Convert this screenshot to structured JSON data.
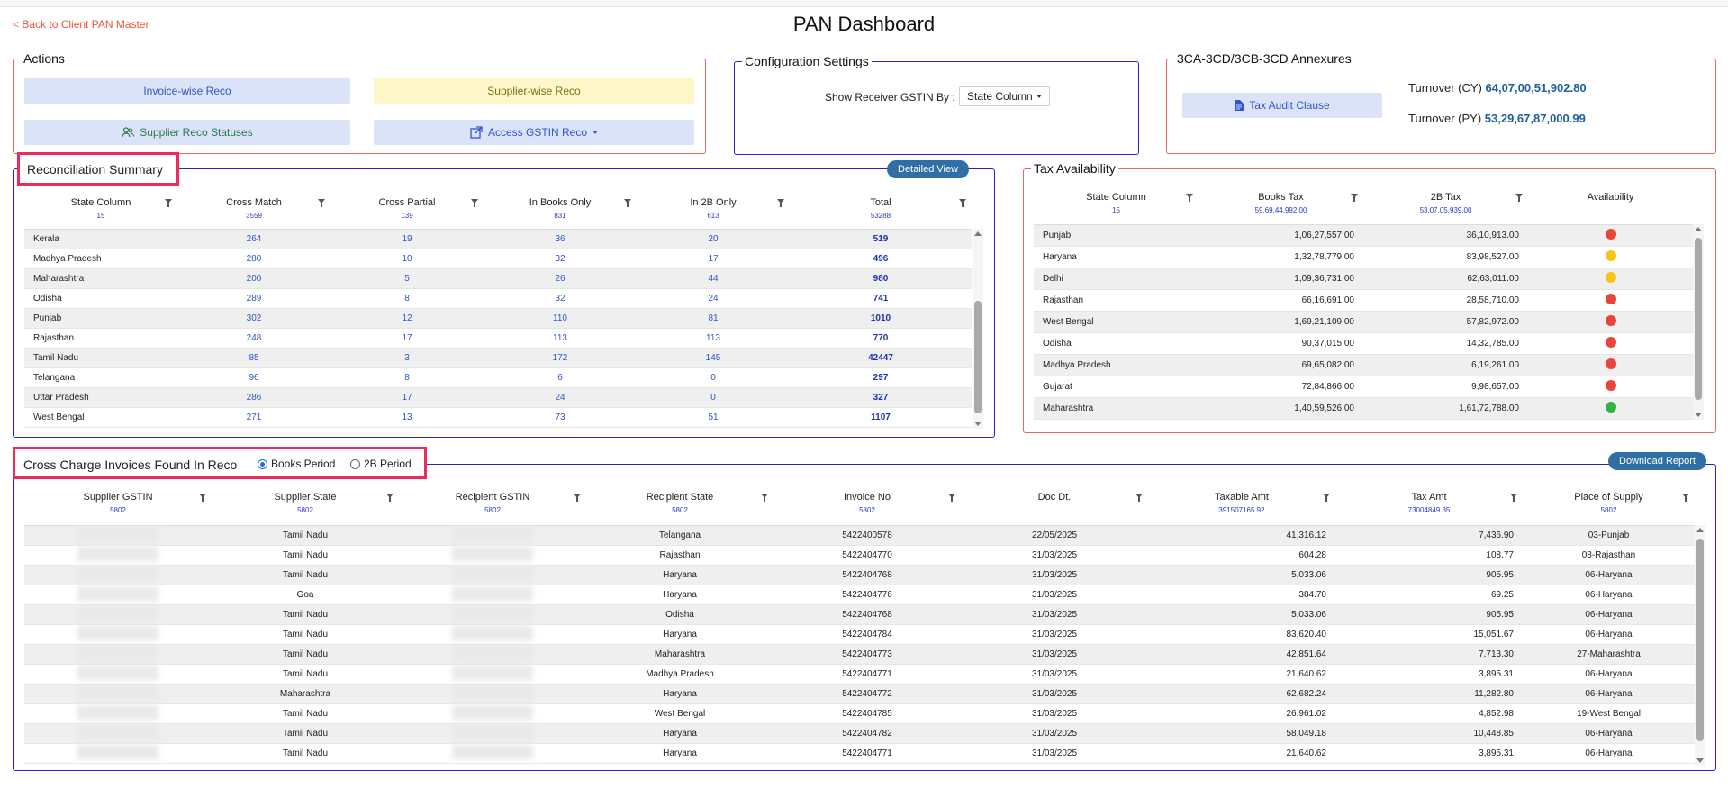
{
  "header": {
    "back_link": "< Back to Client PAN Master",
    "title": "PAN Dashboard"
  },
  "actions": {
    "legend": "Actions",
    "invoice_wise": "Invoice-wise Reco",
    "supplier_wise": "Supplier-wise Reco",
    "supplier_statuses": "Supplier Reco Statuses",
    "access_gstin": "Access GSTIN Reco"
  },
  "config": {
    "legend": "Configuration Settings",
    "label": "Show Receiver GSTIN By :",
    "selected": "State Column"
  },
  "annex": {
    "legend": "3CA-3CD/3CB-3CD Annexures",
    "button": "Tax Audit Clause",
    "turnover_cy_label": "Turnover (CY)",
    "turnover_cy": "64,07,00,51,902.80",
    "turnover_py_label": "Turnover (PY)",
    "turnover_py": "53,29,67,87,000.99"
  },
  "reco": {
    "legend": "Reconciliation Summary",
    "detailed_view": "Detailed View",
    "headers": [
      {
        "label": "State Column",
        "count": "15"
      },
      {
        "label": "Cross Match",
        "count": "3559"
      },
      {
        "label": "Cross Partial",
        "count": "139"
      },
      {
        "label": "In Books Only",
        "count": "831"
      },
      {
        "label": "In 2B Only",
        "count": "613"
      },
      {
        "label": "Total",
        "count": "53288"
      }
    ],
    "rows": [
      [
        "Kerala",
        "264",
        "19",
        "36",
        "20",
        "519"
      ],
      [
        "Madhya Pradesh",
        "280",
        "10",
        "32",
        "17",
        "496"
      ],
      [
        "Maharashtra",
        "200",
        "5",
        "26",
        "44",
        "980"
      ],
      [
        "Odisha",
        "289",
        "8",
        "32",
        "24",
        "741"
      ],
      [
        "Punjab",
        "302",
        "12",
        "110",
        "81",
        "1010"
      ],
      [
        "Rajasthan",
        "248",
        "17",
        "113",
        "113",
        "770"
      ],
      [
        "Tamil Nadu",
        "85",
        "3",
        "172",
        "145",
        "42447"
      ],
      [
        "Telangana",
        "96",
        "8",
        "6",
        "0",
        "297"
      ],
      [
        "Uttar Pradesh",
        "286",
        "17",
        "24",
        "0",
        "327"
      ],
      [
        "West Bengal",
        "271",
        "13",
        "73",
        "51",
        "1107"
      ]
    ]
  },
  "tax": {
    "legend": "Tax Availability",
    "headers": [
      {
        "label": "State Column",
        "count": "15"
      },
      {
        "label": "Books Tax",
        "count": "59,69,44,992.00"
      },
      {
        "label": "2B Tax",
        "count": "53,07,05,939.00"
      },
      {
        "label": "Availability",
        "count": ""
      }
    ],
    "colors": {
      "red": "#e8453c",
      "yellow": "#f5c518",
      "green": "#2fb344"
    },
    "rows": [
      {
        "state": "Punjab",
        "books": "1,06,27,557.00",
        "tax2b": "36,10,913.00",
        "status": "red"
      },
      {
        "state": "Haryana",
        "books": "1,32,78,779.00",
        "tax2b": "83,98,527.00",
        "status": "yellow"
      },
      {
        "state": "Delhi",
        "books": "1,09,36,731.00",
        "tax2b": "62,63,011.00",
        "status": "yellow"
      },
      {
        "state": "Rajasthan",
        "books": "66,16,691.00",
        "tax2b": "28,58,710.00",
        "status": "red"
      },
      {
        "state": "West Bengal",
        "books": "1,69,21,109.00",
        "tax2b": "57,82,972.00",
        "status": "red"
      },
      {
        "state": "Odisha",
        "books": "90,37,015.00",
        "tax2b": "14,32,785.00",
        "status": "red"
      },
      {
        "state": "Madhya Pradesh",
        "books": "69,65,082.00",
        "tax2b": "6,19,261.00",
        "status": "red"
      },
      {
        "state": "Gujarat",
        "books": "72,84,866.00",
        "tax2b": "9,98,657.00",
        "status": "red"
      },
      {
        "state": "Maharashtra",
        "books": "1,40,59,526.00",
        "tax2b": "1,61,72,788.00",
        "status": "green"
      }
    ]
  },
  "cross": {
    "legend": "Cross Charge Invoices Found In Reco",
    "radio_books": "Books Period",
    "radio_2b": "2B Period",
    "download": "Download Report",
    "headers": [
      {
        "label": "Supplier GSTIN",
        "count": "5802"
      },
      {
        "label": "Supplier State",
        "count": "5802"
      },
      {
        "label": "Recipient GSTIN",
        "count": "5802"
      },
      {
        "label": "Recipient State",
        "count": "5802"
      },
      {
        "label": "Invoice No",
        "count": "5802"
      },
      {
        "label": "Doc Dt.",
        "count": ""
      },
      {
        "label": "Taxable Amt",
        "count": "391507165.92"
      },
      {
        "label": "Tax Amt",
        "count": "73004849.35"
      },
      {
        "label": "Place of Supply",
        "count": "5802"
      }
    ],
    "rows": [
      [
        "Tamil Nadu",
        "Telangana",
        "5422400578",
        "22/05/2025",
        "41,316.12",
        "7,436.90",
        "03-Punjab"
      ],
      [
        "Tamil Nadu",
        "Rajasthan",
        "5422404770",
        "31/03/2025",
        "604.28",
        "108.77",
        "08-Rajasthan"
      ],
      [
        "Tamil Nadu",
        "Haryana",
        "5422404768",
        "31/03/2025",
        "5,033.06",
        "905.95",
        "06-Haryana"
      ],
      [
        "Goa",
        "Haryana",
        "5422404776",
        "31/03/2025",
        "384.70",
        "69.25",
        "06-Haryana"
      ],
      [
        "Tamil Nadu",
        "Odisha",
        "5422404768",
        "31/03/2025",
        "5,033.06",
        "905.95",
        "06-Haryana"
      ],
      [
        "Tamil Nadu",
        "Haryana",
        "5422404784",
        "31/03/2025",
        "83,620.40",
        "15,051.67",
        "06-Haryana"
      ],
      [
        "Tamil Nadu",
        "Maharashtra",
        "5422404773",
        "31/03/2025",
        "42,851.64",
        "7,713.30",
        "27-Maharashtra"
      ],
      [
        "Tamil Nadu",
        "Madhya Pradesh",
        "5422404771",
        "31/03/2025",
        "21,640.62",
        "3,895.31",
        "06-Haryana"
      ],
      [
        "Maharashtra",
        "Haryana",
        "5422404772",
        "31/03/2025",
        "62,682.24",
        "11,282.80",
        "06-Haryana"
      ],
      [
        "Tamil Nadu",
        "West Bengal",
        "5422404785",
        "31/03/2025",
        "26,961.02",
        "4,852.98",
        "19-West Bengal"
      ],
      [
        "Tamil Nadu",
        "Haryana",
        "5422404782",
        "31/03/2025",
        "58,049.18",
        "10,448.85",
        "06-Haryana"
      ],
      [
        "Tamil Nadu",
        "Haryana",
        "5422404771",
        "31/03/2025",
        "21,640.62",
        "3,895.31",
        "06-Haryana"
      ]
    ]
  }
}
